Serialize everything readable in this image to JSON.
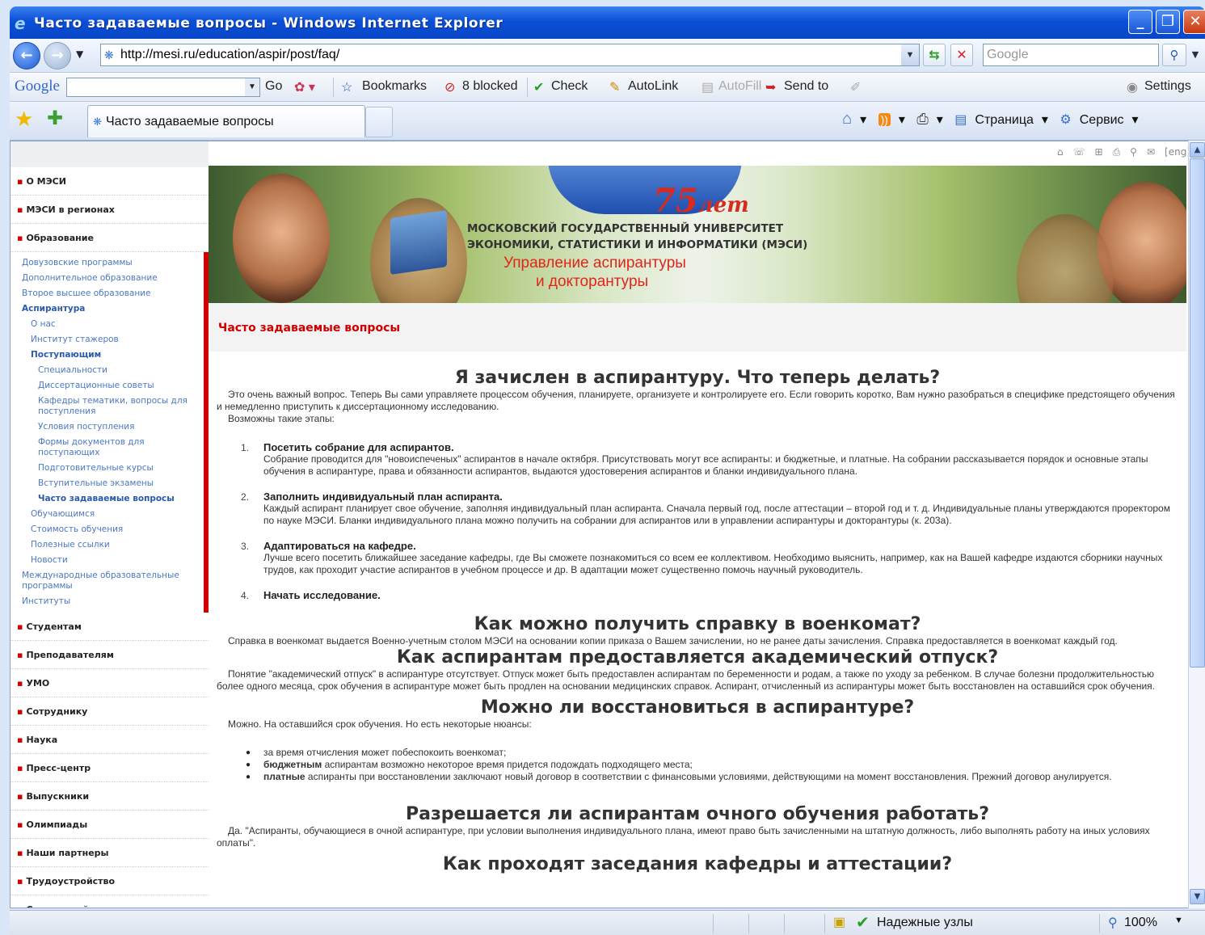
{
  "window": {
    "title": "Часто задаваемые вопросы - Windows Internet Explorer",
    "min": "_",
    "max": "❐",
    "close": "✕"
  },
  "address": {
    "url": "http://mesi.ru/education/aspir/post/faq/",
    "search_placeholder": "Google"
  },
  "google_toolbar": {
    "logo": "Google",
    "go": "Go",
    "bookmarks": "Bookmarks",
    "blocked": "8 blocked",
    "check": "Check",
    "autolink": "AutoLink",
    "autofill": "AutoFill",
    "sendto": "Send to",
    "settings": "Settings"
  },
  "tab": {
    "label": "Часто задаваемые вопросы"
  },
  "command_bar": {
    "page": "Страница",
    "service": "Сервис"
  },
  "status": {
    "zone": "Надежные узлы",
    "zoom": "100%"
  },
  "topicons": {
    "lang": "[eng]"
  },
  "banner": {
    "years": "75",
    "years_word": "лет",
    "uni_line1": "МОСКОВСКИЙ ГОСУДАРСТВЕННЫЙ УНИВЕРСИТЕТ",
    "uni_line2": "ЭКОНОМИКИ, СТАТИСТИКИ И ИНФОРМАТИКИ (МЭСИ)",
    "dept_line1": "Управление аспирантуры",
    "dept_line2": "и докторантуры"
  },
  "page_title": "Часто задаваемые вопросы",
  "sidebar": {
    "top_items": [
      "О МЭСИ",
      "МЭСИ в регионах",
      "Образование"
    ],
    "sub_items": [
      {
        "label": "Довузовские программы",
        "level": 0,
        "bold": false
      },
      {
        "label": "Дополнительное образование",
        "level": 0,
        "bold": false
      },
      {
        "label": "Второе высшее образование",
        "level": 0,
        "bold": false
      },
      {
        "label": "Аспирантура",
        "level": 0,
        "bold": true
      },
      {
        "label": "О нас",
        "level": 1,
        "bold": false
      },
      {
        "label": "Институт стажеров",
        "level": 1,
        "bold": false
      },
      {
        "label": "Поступающим",
        "level": 1,
        "bold": true
      },
      {
        "label": "Специальности",
        "level": 2,
        "bold": false
      },
      {
        "label": "Диссертационные советы",
        "level": 2,
        "bold": false
      },
      {
        "label": "Кафедры тематики, вопросы для поступления",
        "level": 2,
        "bold": false
      },
      {
        "label": "Условия поступления",
        "level": 2,
        "bold": false
      },
      {
        "label": "Формы документов для поступающих",
        "level": 2,
        "bold": false
      },
      {
        "label": "Подготовительные курсы",
        "level": 2,
        "bold": false
      },
      {
        "label": "Вступительные экзамены",
        "level": 2,
        "bold": false
      },
      {
        "label": "Часто задаваемые вопросы",
        "level": 2,
        "bold": true
      },
      {
        "label": "Обучающимся",
        "level": 1,
        "bold": false
      },
      {
        "label": "Стоимость обучения",
        "level": 1,
        "bold": false
      },
      {
        "label": "Полезные ссылки",
        "level": 1,
        "bold": false
      },
      {
        "label": "Новости",
        "level": 1,
        "bold": false
      },
      {
        "label": "Международные образовательные программы",
        "level": 0,
        "bold": false
      },
      {
        "label": "Институты",
        "level": 0,
        "bold": false
      }
    ],
    "bottom_items": [
      "Студентам",
      "Преподавателям",
      "УМО",
      "Сотруднику",
      "Наука",
      "Пресс-центр",
      "Выпускники",
      "Олимпиады",
      "Наши партнеры",
      "Трудоустройство",
      "Спортивный менеджмент"
    ]
  },
  "article": {
    "q1": {
      "title": "Я зачислен в аспирантуру. Что теперь делать?",
      "intro": "Это очень важный вопрос. Теперь Вы сами управляете процессом обучения, планируете, организуете и контролируете его. Если говорить коротко, Вам нужно разобраться в специфике предстоящего обучения и немедленно приступить к диссертационному исследованию.",
      "intro2": "Возможны такие этапы:",
      "steps": [
        {
          "n": "1.",
          "title": "Посетить собрание для аспирантов.",
          "text": "Собрание проводится для \"новоиспеченых\" аспирантов в начале октября. Присутствовать могут все аспиранты: и бюджетные, и платные. На собрании рассказывается порядок и основные этапы обучения в аспирантуре, права и обязанности аспирантов, выдаются удостоверения аспирантов и бланки индивидуального плана."
        },
        {
          "n": "2.",
          "title": "Заполнить индивидуальный план аспиранта.",
          "text": "Каждый аспирант планирует свое обучение, заполняя индивидуальный план аспиранта. Сначала первый год, после аттестации – второй год и т. д. Индивидуальные планы утверждаются проректором по науке МЭСИ. Бланки индивидуального плана можно получить на собрании для аспирантов или в управлении аспирантуры и докторантуры (к. 203а)."
        },
        {
          "n": "3.",
          "title": "Адаптироваться на кафедре.",
          "text": "Лучше всего посетить ближайшее заседание кафедры, где Вы сможете познакомиться со всем ее коллективом. Необходимо выяснить, например, как на Вашей кафедре издаются сборники научных трудов, как проходит участие аспирантов в учебном процессе и др. В адаптации может существенно помочь научный руководитель."
        },
        {
          "n": "4.",
          "title": "Начать исследование.",
          "text": ""
        }
      ]
    },
    "q2": {
      "title": "Как можно получить справку в военкомат?",
      "text": "Справка в военкомат выдается Военно-учетным столом МЭСИ на основании копии приказа о Вашем зачислении, но не ранее даты зачисления. Справка предоставляется в военкомат каждый год."
    },
    "q3": {
      "title": "Как аспирантам предоставляется академический отпуск?",
      "text": "Понятие \"академический отпуск\" в аспирантуре отсутствует. Отпуск может быть предоставлен аспирантам по беременности и родам, а также по уходу за ребенком. В случае болезни продолжительностью более одного месяца, срок обучения в аспирантуре может быть продлен на основании медицинских справок. Аспирант, отчисленный из аспирантуры может быть восстановлен на оставшийся срок обучения."
    },
    "q4": {
      "title": "Можно ли восстановиться в аспирантуре?",
      "text": "Можно. На оставшийся срок обучения. Но есть некоторые нюансы:",
      "bullets": [
        {
          "b": "",
          "t": "за время отчисления может побеспокоить военкомат;"
        },
        {
          "b": "бюджетным",
          "t": " аспирантам возможно некоторое время придется подождать подходящего места;"
        },
        {
          "b": "платные",
          "t": " аспиранты при восстановлении заключают новый договор в соответствии с финансовыми условиями, действующими на момент восстановления. Прежний договор анулируется."
        }
      ]
    },
    "q5": {
      "title": "Разрешается ли аспирантам очного обучения работать?",
      "text": "Да. \"Аспиранты, обучающиеся в очной аспирантуре, при условии выполнения индивидуального плана, имеют право быть зачисленными на штатную должность, либо выполнять работу на иных условиях оплаты\"."
    },
    "q6": {
      "title": "Как проходят заседания кафедры и аттестации?"
    }
  }
}
